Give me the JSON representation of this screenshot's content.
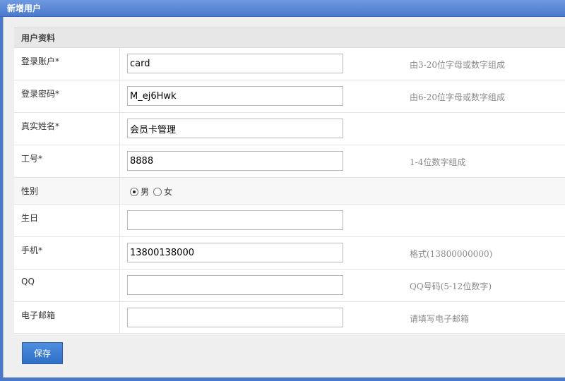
{
  "window": {
    "title": "新增用户"
  },
  "panel": {
    "header": "用户资料"
  },
  "fields": [
    {
      "label": "登录账户*",
      "value": "card",
      "hint": "由3-20位字母或数字组成"
    },
    {
      "label": "登录密码*",
      "value": "M_ej6Hwk",
      "hint": "由6-20位字母或数字组成"
    },
    {
      "label": "真实姓名*",
      "value": "会员卡管理",
      "hint": ""
    },
    {
      "label": "工号*",
      "value": "8888",
      "hint": "1-4位数字组成"
    },
    {
      "label": "性别",
      "options": [
        "男",
        "女"
      ],
      "selected": "男"
    },
    {
      "label": "生日",
      "value": "",
      "hint": ""
    },
    {
      "label": "手机*",
      "value": "13800138000",
      "hint": "格式(13800000000)"
    },
    {
      "label": "QQ",
      "value": "",
      "hint": "QQ号码(5-12位数字)"
    },
    {
      "label": "电子邮箱",
      "value": "",
      "hint": "请填写电子邮箱"
    }
  ],
  "actions": {
    "save_label": "保存"
  },
  "colors": {
    "titlebar": "#4a78cc",
    "button": "#3a7bd5",
    "hint": "#8a8a8a"
  }
}
